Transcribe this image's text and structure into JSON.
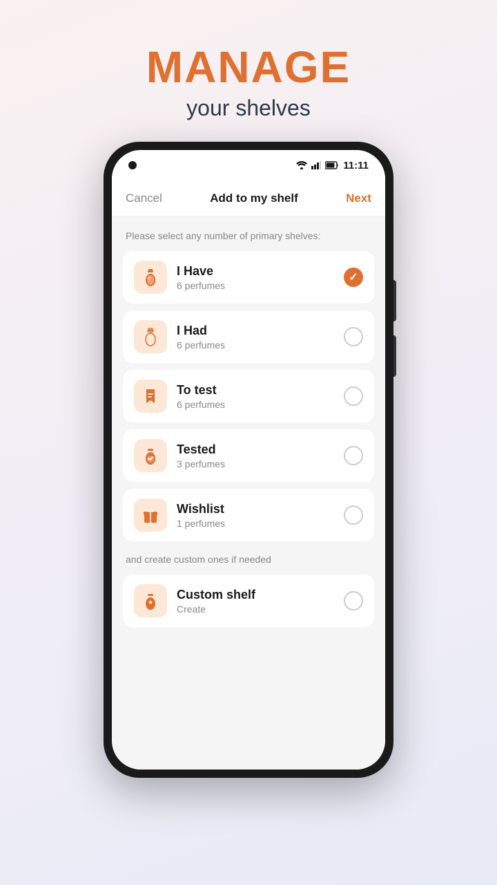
{
  "header": {
    "title_main": "MANAGE",
    "title_sub": "your shelves"
  },
  "status_bar": {
    "time": "11:11"
  },
  "nav": {
    "cancel": "Cancel",
    "title": "Add to my shelf",
    "next": "Next"
  },
  "section_label": "Please select any number of primary shelves:",
  "custom_section_label": "and create custom ones if needed",
  "shelves": [
    {
      "name": "I Have",
      "count": "6 perfumes",
      "checked": true,
      "icon_type": "perfume_bottle"
    },
    {
      "name": "I Had",
      "count": "6 perfumes",
      "checked": false,
      "icon_type": "perfume_bottle_outline"
    },
    {
      "name": "To test",
      "count": "6 perfumes",
      "checked": false,
      "icon_type": "bookmark"
    },
    {
      "name": "Tested",
      "count": "3 perfumes",
      "checked": false,
      "icon_type": "perfume_check"
    },
    {
      "name": "Wishlist",
      "count": "1 perfumes",
      "checked": false,
      "icon_type": "gift"
    }
  ],
  "custom_shelf": {
    "name": "Custom shelf",
    "sub": "Create",
    "checked": false,
    "icon_type": "perfume_star"
  },
  "colors": {
    "accent": "#e07030",
    "bg": "#f5f5f5",
    "icon_bg": "#fde8d8"
  }
}
